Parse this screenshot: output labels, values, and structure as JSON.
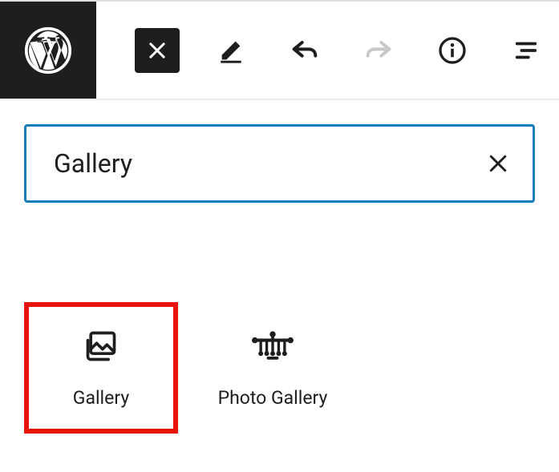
{
  "search": {
    "value": "Gallery"
  },
  "results": {
    "items": [
      {
        "label": "Gallery"
      },
      {
        "label": "Photo Gallery"
      }
    ]
  }
}
